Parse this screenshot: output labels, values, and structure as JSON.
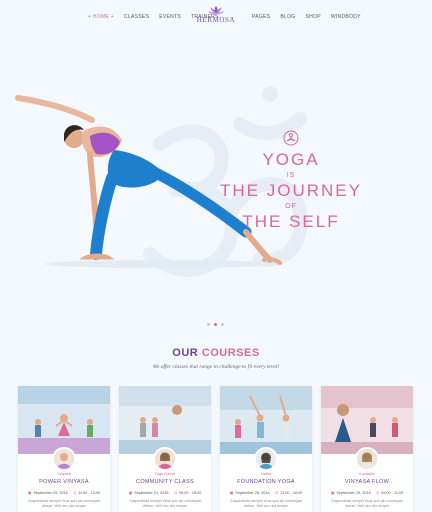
{
  "nav": {
    "left": [
      {
        "label": "+ HOME +",
        "active": true
      },
      {
        "label": "CLASSES"
      },
      {
        "label": "EVENTS"
      },
      {
        "label": "TRAINERS"
      }
    ],
    "right": [
      {
        "label": "PAGES"
      },
      {
        "label": "BLOG"
      },
      {
        "label": "SHOP"
      },
      {
        "label": "WINDBODY"
      }
    ],
    "logo": "HERMOSA"
  },
  "hero": {
    "line1": "YOGA",
    "line2": "IS",
    "line3": "THE JOURNEY",
    "line4": "OF",
    "line5": "THE SELF",
    "slides": 3,
    "active_slide": 2
  },
  "courses": {
    "title_a": "OUR",
    "title_b": "COURSES",
    "subtitle": "We offer classes that range in challenge to fit every level!",
    "items": [
      {
        "category": "Vinyasa",
        "title": "POWER VINYASA",
        "date": "September 29, 2016",
        "time": "11:00 - 13:00",
        "desc": "Suspendisse semper risus quis lph consequat dictum. Velit nec ulla morper"
      },
      {
        "category": "Yoga Dance",
        "title": "COMMUNITY CLASS",
        "date": "September 21, 2016",
        "time": "09:00 - 15:00",
        "desc": "Suspendisse semper risus quis lph consequat dictum. Velit nec ulla morper"
      },
      {
        "category": "Hatha",
        "title": "FOUNDATION YOGA",
        "date": "September 28, 2016",
        "time": "13:00 - 16:00",
        "desc": "Suspendisse semper risus quis lph consequat dictum. Velit nec ulla morper"
      },
      {
        "category": "Kundalini",
        "title": "VINYASA FLOW",
        "date": "September 29, 2016",
        "time": "09:00 - 11:00",
        "desc": "Suspendisse semper risus quis lph consequat dictum. Velit nec ulla morper"
      }
    ]
  },
  "colors": {
    "accent_pink": "#d9679b",
    "accent_purple": "#6b3fa0",
    "background": "#f4f9fd"
  },
  "icons": {
    "calendar": "calendar-icon",
    "clock": "clock-icon",
    "lotus": "lotus-icon",
    "meditate": "meditation-icon"
  }
}
